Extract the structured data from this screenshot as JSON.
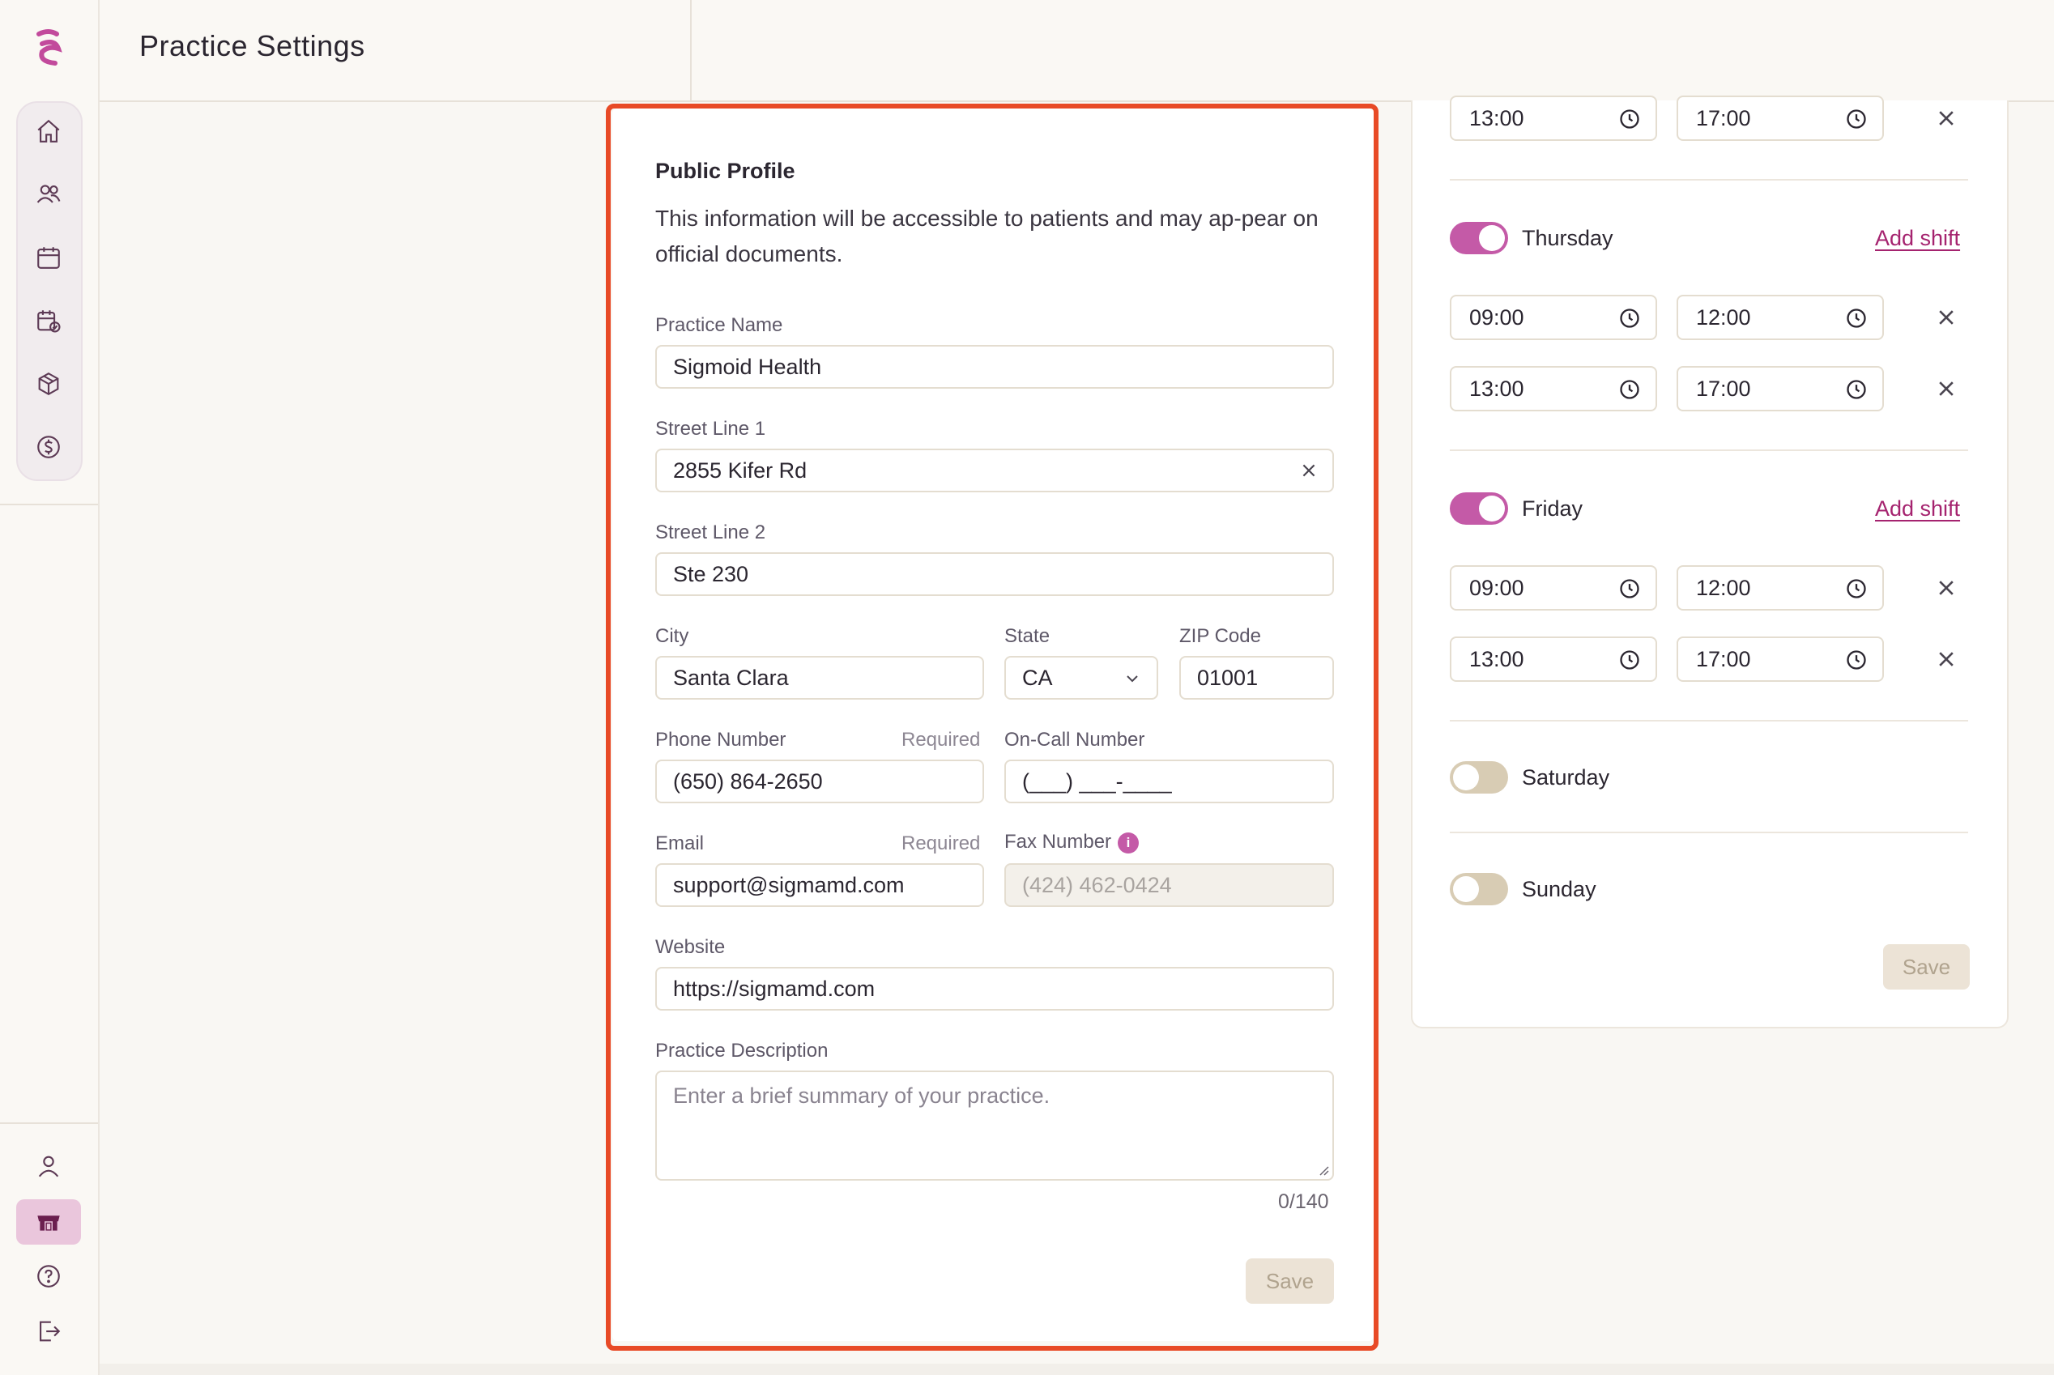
{
  "header": {
    "title": "Practice Settings"
  },
  "sidebar": {
    "nav": [
      "home-icon",
      "users-icon",
      "calendar-icon",
      "calendar-check-icon",
      "box-icon",
      "dollar-icon"
    ],
    "bottom": [
      "profile-icon",
      "practice-icon",
      "help-icon",
      "logout-icon"
    ],
    "active": "practice-icon",
    "accent": "#c45aa7"
  },
  "profile": {
    "title": "Public Profile",
    "description": "This information will be accessible to patients and may ap-pear on official documents.",
    "practice_name": {
      "label": "Practice Name",
      "value": "Sigmoid Health"
    },
    "street1": {
      "label": "Street Line 1",
      "value": "2855 Kifer Rd"
    },
    "street2": {
      "label": "Street Line 2",
      "value": "Ste 230"
    },
    "city": {
      "label": "City",
      "value": "Santa Clara"
    },
    "state": {
      "label": "State",
      "value": "CA"
    },
    "zip": {
      "label": "ZIP Code",
      "value": "01001"
    },
    "phone": {
      "label": "Phone Number",
      "required": "Required",
      "value": "(650) 864-2650"
    },
    "oncall": {
      "label": "On-Call Number",
      "value": "(___) ___-____"
    },
    "email": {
      "label": "Email",
      "required": "Required",
      "value": "support@sigmamd.com"
    },
    "fax": {
      "label": "Fax Number",
      "info": "i",
      "placeholder": "(424) 462-0424"
    },
    "website": {
      "label": "Website",
      "value": "https://sigmamd.com"
    },
    "desc": {
      "label": "Practice Description",
      "placeholder": "Enter a brief summary of your practice.",
      "counter": "0/140"
    },
    "save": "Save"
  },
  "hours": {
    "partial_top": {
      "start": "13:00",
      "end": "17:00"
    },
    "thursday": {
      "day": "Thursday",
      "enabled": true,
      "add": "Add shift",
      "shifts": [
        {
          "start": "09:00",
          "end": "12:00"
        },
        {
          "start": "13:00",
          "end": "17:00"
        }
      ]
    },
    "friday": {
      "day": "Friday",
      "enabled": true,
      "add": "Add shift",
      "shifts": [
        {
          "start": "09:00",
          "end": "12:00"
        },
        {
          "start": "13:00",
          "end": "17:00"
        }
      ]
    },
    "saturday": {
      "day": "Saturday",
      "enabled": false
    },
    "sunday": {
      "day": "Sunday",
      "enabled": false
    },
    "save": "Save"
  }
}
